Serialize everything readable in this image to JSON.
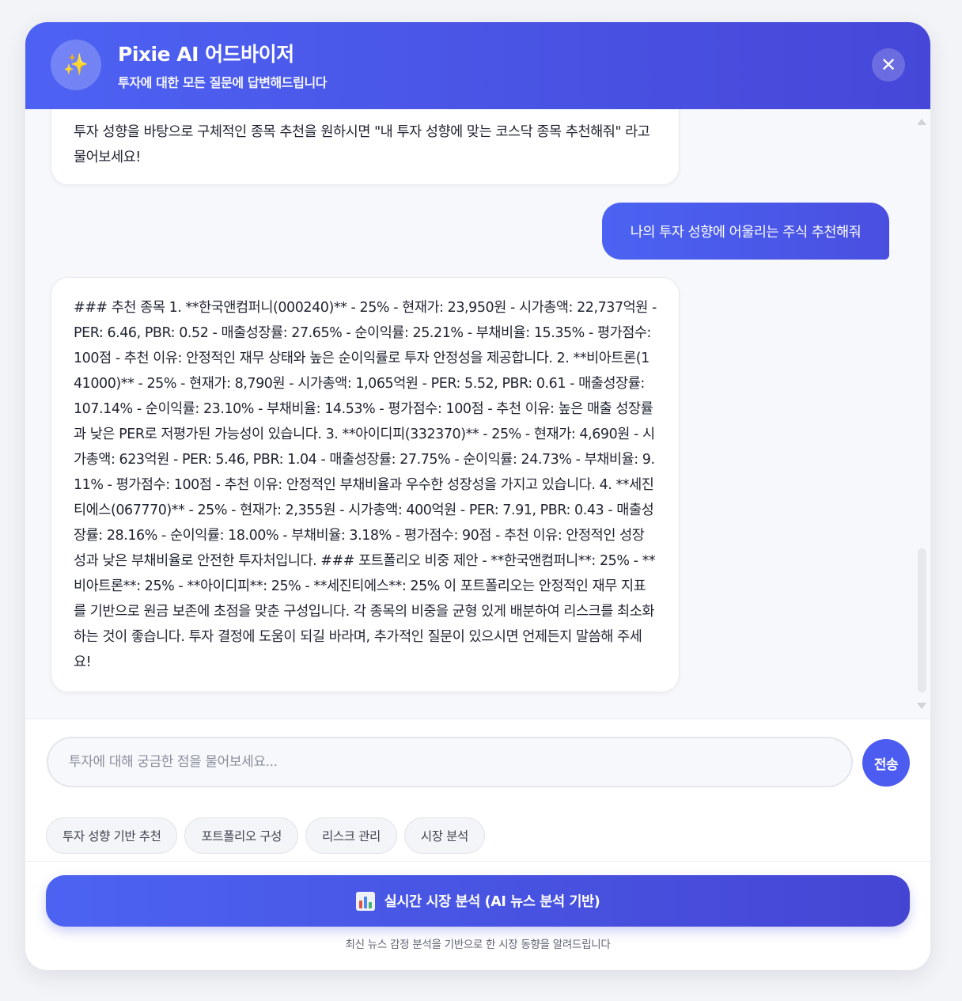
{
  "header": {
    "avatar_icon": "✨",
    "title": "Pixie AI 어드바이저",
    "subtitle": "투자에 대한 모든 질문에 답변해드립니다",
    "close_icon": "✕"
  },
  "messages": [
    {
      "role": "assistant",
      "text": "투자 성향을 바탕으로 구체적인 종목 추천을 원하시면 \"내 투자 성향에 맞는 코스닥 종목 추천해줘\" 라고 물어보세요!"
    },
    {
      "role": "user",
      "text": "나의 투자 성향에 어울리는 주식 추천해줘"
    },
    {
      "role": "assistant",
      "text": "### 추천 종목 1. **한국앤컴퍼니(000240)** - 25% - 현재가: 23,950원 - 시가총액: 22,737억원 - PER: 6.46, PBR: 0.52 - 매출성장률: 27.65% - 순이익률: 25.21% - 부채비율: 15.35% - 평가점수: 100점 - 추천 이유: 안정적인 재무 상태와 높은 순이익률로 투자 안정성을 제공합니다. 2. **비아트론(141000)** - 25% - 현재가: 8,790원 - 시가총액: 1,065억원 - PER: 5.52, PBR: 0.61 - 매출성장률: 107.14% - 순이익률: 23.10% - 부채비율: 14.53% - 평가점수: 100점 - 추천 이유: 높은 매출 성장률과 낮은 PER로 저평가된 가능성이 있습니다. 3. **아이디피(332370)** - 25% - 현재가: 4,690원 - 시가총액: 623억원 - PER: 5.46, PBR: 1.04 - 매출성장률: 27.75% - 순이익률: 24.73% - 부채비율: 9.11% - 평가점수: 100점 - 추천 이유: 안정적인 부채비율과 우수한 성장성을 가지고 있습니다. 4. **세진티에스(067770)** - 25% - 현재가: 2,355원 - 시가총액: 400억원 - PER: 7.91, PBR: 0.43 - 매출성장률: 28.16% - 순이익률: 18.00% - 부채비율: 3.18% - 평가점수: 90점 - 추천 이유: 안정적인 성장성과 낮은 부채비율로 안전한 투자처입니다. ### 포트폴리오 비중 제안 - **한국앤컴퍼니**: 25% - **비아트론**: 25% - **아이디피**: 25% - **세진티에스**: 25% 이 포트폴리오는 안정적인 재무 지표를 기반으로 원금 보존에 초점을 맞춘 구성입니다. 각 종목의 비중을 균형 있게 배분하여 리스크를 최소화하는 것이 좋습니다. 투자 결정에 도움이 되길 바라며, 추가적인 질문이 있으시면 언제든지 말씀해 주세요!"
    }
  ],
  "input": {
    "placeholder": "투자에 대해 궁금한 점을 물어보세요...",
    "value": "",
    "send_label": "전송"
  },
  "quick_actions": [
    "투자 성향 기반 추천",
    "포트폴리오 구성",
    "리스크 관리",
    "시장 분석"
  ],
  "footer": {
    "market_button_icon": "bar-chart-icon",
    "market_button_label": "실시간 시장 분석 (AI 뉴스 분석 기반)",
    "note": "최신 뉴스 감정 분석을 기반으로 한 시장 동향을 알려드립니다"
  },
  "colors": {
    "accent": "#4d62f3",
    "accent_dark": "#4545d3",
    "background": "#f7f8fb"
  }
}
